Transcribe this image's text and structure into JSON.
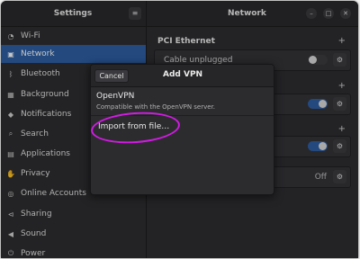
{
  "left_header": {
    "title": "Settings",
    "menu_icon": "≡"
  },
  "right_header": {
    "title": "Network"
  },
  "window_controls": [
    "–",
    "□",
    "✕"
  ],
  "sidebar": {
    "items": [
      {
        "icon": "wifi-icon",
        "glyph": "◔",
        "label": "Wi-Fi",
        "active": false
      },
      {
        "icon": "network-icon",
        "glyph": "▣",
        "label": "Network",
        "active": true
      },
      {
        "icon": "bluetooth-icon",
        "glyph": "ᛒ",
        "label": "Bluetooth",
        "active": false
      },
      {
        "icon": "background-icon",
        "glyph": "▦",
        "label": "Background",
        "active": false
      },
      {
        "icon": "notifications-icon",
        "glyph": "◆",
        "label": "Notifications",
        "active": false
      },
      {
        "icon": "search-icon",
        "glyph": "⌕",
        "label": "Search",
        "active": false
      },
      {
        "icon": "applications-icon",
        "glyph": "▤",
        "label": "Applications",
        "active": false
      },
      {
        "icon": "privacy-icon",
        "glyph": "✋",
        "label": "Privacy",
        "active": false
      },
      {
        "icon": "online-accounts-icon",
        "glyph": "◎",
        "label": "Online Accounts",
        "active": false
      },
      {
        "icon": "sharing-icon",
        "glyph": "⊲",
        "label": "Sharing",
        "active": false
      },
      {
        "icon": "sound-icon",
        "glyph": "◀",
        "label": "Sound",
        "active": false
      },
      {
        "icon": "power-icon",
        "glyph": "⏻",
        "label": "Power",
        "active": false
      }
    ]
  },
  "main": {
    "pci_ethernet": {
      "title": "PCI Ethernet",
      "add": "+",
      "status": "Cable unplugged"
    },
    "row2": {
      "toggle_on": true
    },
    "row3": {
      "toggle_on": true
    },
    "row4": {
      "state": "Off"
    },
    "gear_glyph": "⚙"
  },
  "dialog": {
    "cancel_label": "Cancel",
    "title": "Add VPN",
    "option_title": "OpenVPN",
    "option_desc": "Compatible with the OpenVPN server.",
    "import_label": "Import from file…"
  },
  "colors": {
    "accent": "#2d5ea3",
    "highlight": "#d21be3"
  }
}
